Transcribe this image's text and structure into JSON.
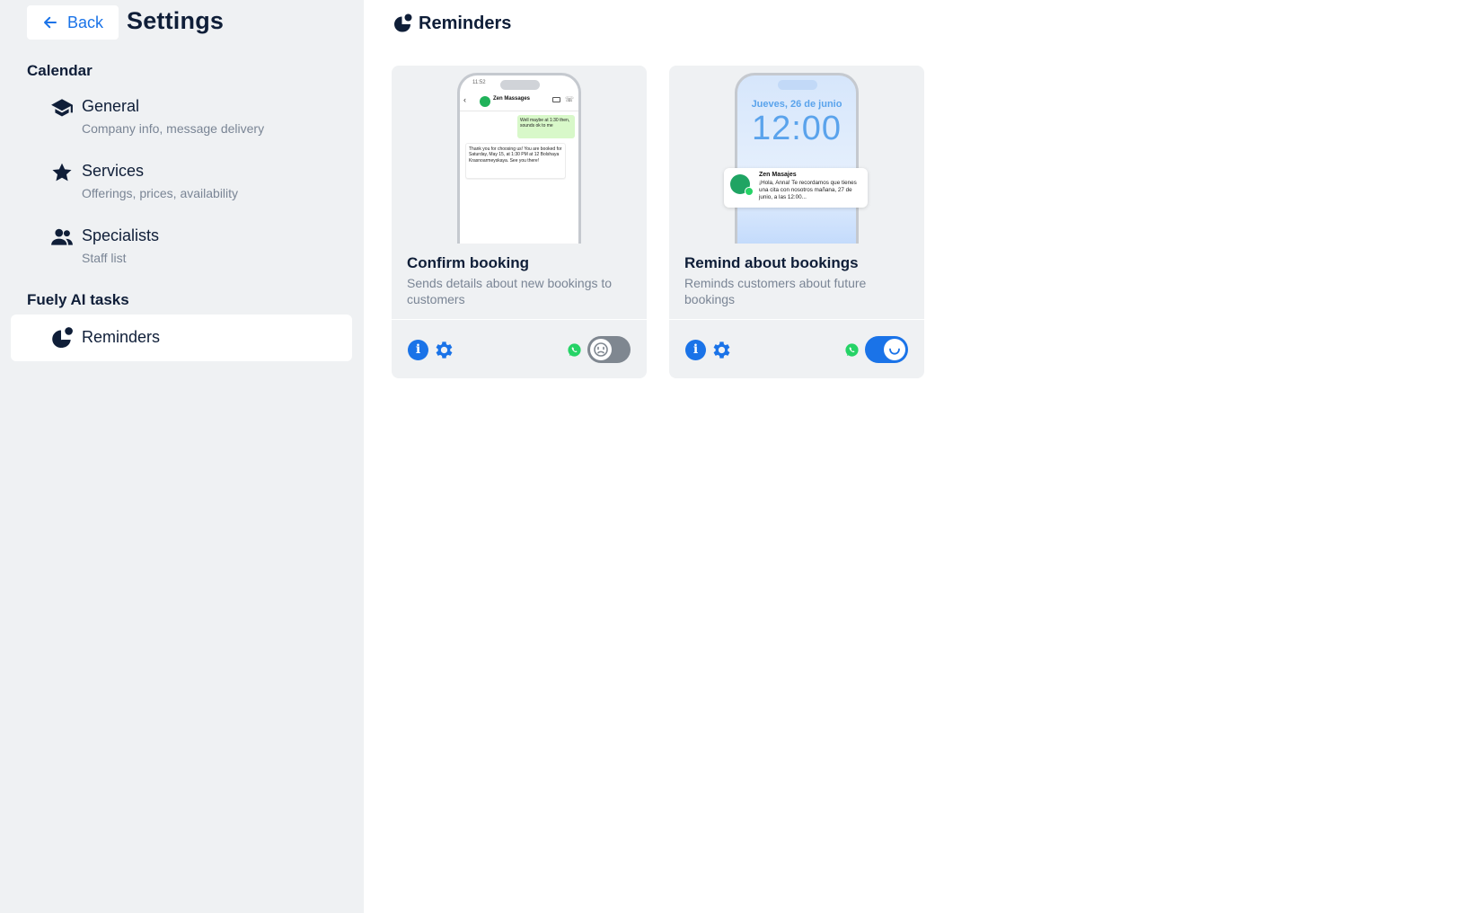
{
  "window": {
    "back_label": "Back",
    "title": "Settings"
  },
  "sidebar": {
    "sections": [
      {
        "title": "Calendar",
        "items": [
          {
            "label": "General",
            "subtitle": "Company info, message delivery",
            "icon": "graduation-cap-icon"
          },
          {
            "label": "Services",
            "subtitle": "Offerings, prices, availability",
            "icon": "star-icon"
          },
          {
            "label": "Specialists",
            "subtitle": "Staff list",
            "icon": "people-icon"
          }
        ]
      },
      {
        "title": "Fuely AI tasks",
        "items": [
          {
            "label": "Reminders",
            "icon": "reminders-icon",
            "active": true
          }
        ]
      }
    ]
  },
  "main": {
    "title": "Reminders",
    "cards": [
      {
        "title": "Confirm booking",
        "description": "Sends details about new bookings to customers",
        "enabled": false,
        "preview": {
          "time": "11:52",
          "contact": "Zen Massages",
          "outgoing": "Well maybe at 1:30 then, sounds ok to me",
          "incoming": "Thank you for choosing us! You are booked for Saturday, May 15, at 1:30 PM at 12 Bolshaya Krasnoarmeyskaya. See you there!"
        }
      },
      {
        "title": "Remind about bookings",
        "description": "Reminds customers about future bookings",
        "enabled": true,
        "preview": {
          "date": "Jueves, 26 de junio",
          "time": "12:00",
          "notification_title": "Zen Masajes",
          "notification_text": "¡Hola, Anna! Te recordamos que tienes una cita con nosotros mañana, 27 de junio, a las 12:00..."
        }
      }
    ]
  },
  "colors": {
    "accent": "#1a73e8",
    "sidebar_bg": "#eff1f3",
    "text_primary": "#0f1e38",
    "text_secondary": "#7a8595",
    "toggle_off": "#7f8790",
    "whatsapp": "#25d366"
  }
}
